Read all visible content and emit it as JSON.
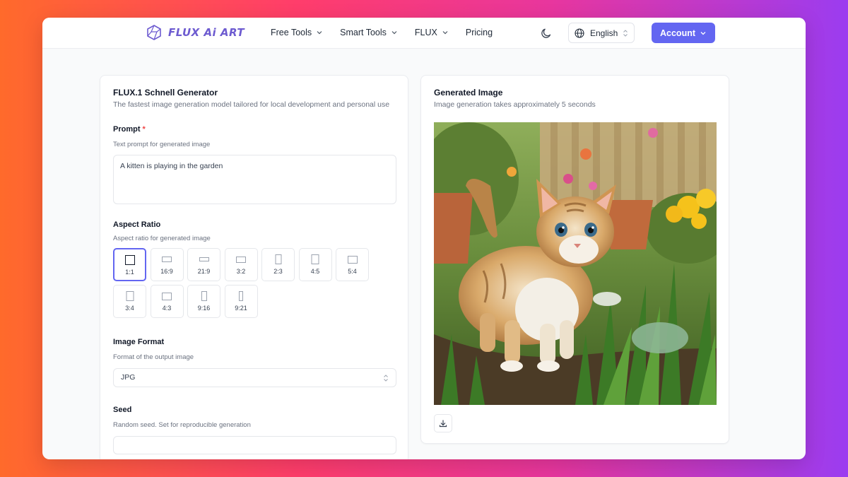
{
  "header": {
    "logo_text": "FLUX Ai ART",
    "nav": [
      {
        "label": "Free Tools",
        "has_dropdown": true
      },
      {
        "label": "Smart Tools",
        "has_dropdown": true
      },
      {
        "label": "FLUX",
        "has_dropdown": true
      },
      {
        "label": "Pricing",
        "has_dropdown": false
      }
    ],
    "theme_icon": "moon-icon",
    "language": "English",
    "account_label": "Account"
  },
  "generator": {
    "title": "FLUX.1 Schnell Generator",
    "subtitle": "The fastest image generation model tailored for local development and personal use",
    "prompt": {
      "label": "Prompt",
      "required_mark": "*",
      "hint": "Text prompt for generated image",
      "value": "A kitten is playing in the garden"
    },
    "aspect_ratio": {
      "label": "Aspect Ratio",
      "hint": "Aspect ratio for generated image",
      "options": [
        "1:1",
        "16:9",
        "21:9",
        "3:2",
        "2:3",
        "4:5",
        "5:4",
        "3:4",
        "4:3",
        "9:16",
        "9:21"
      ],
      "selected": "1:1"
    },
    "image_format": {
      "label": "Image Format",
      "hint": "Format of the output image",
      "value": "JPG"
    },
    "seed": {
      "label": "Seed",
      "hint": "Random seed. Set for reproducible generation",
      "value": ""
    }
  },
  "result": {
    "title": "Generated Image",
    "subtitle": "Image generation takes approximately 5 seconds",
    "download_icon": "download-icon"
  },
  "colors": {
    "accent": "#6366f1",
    "logo": "#6d5bd0",
    "required": "#ef4444"
  }
}
